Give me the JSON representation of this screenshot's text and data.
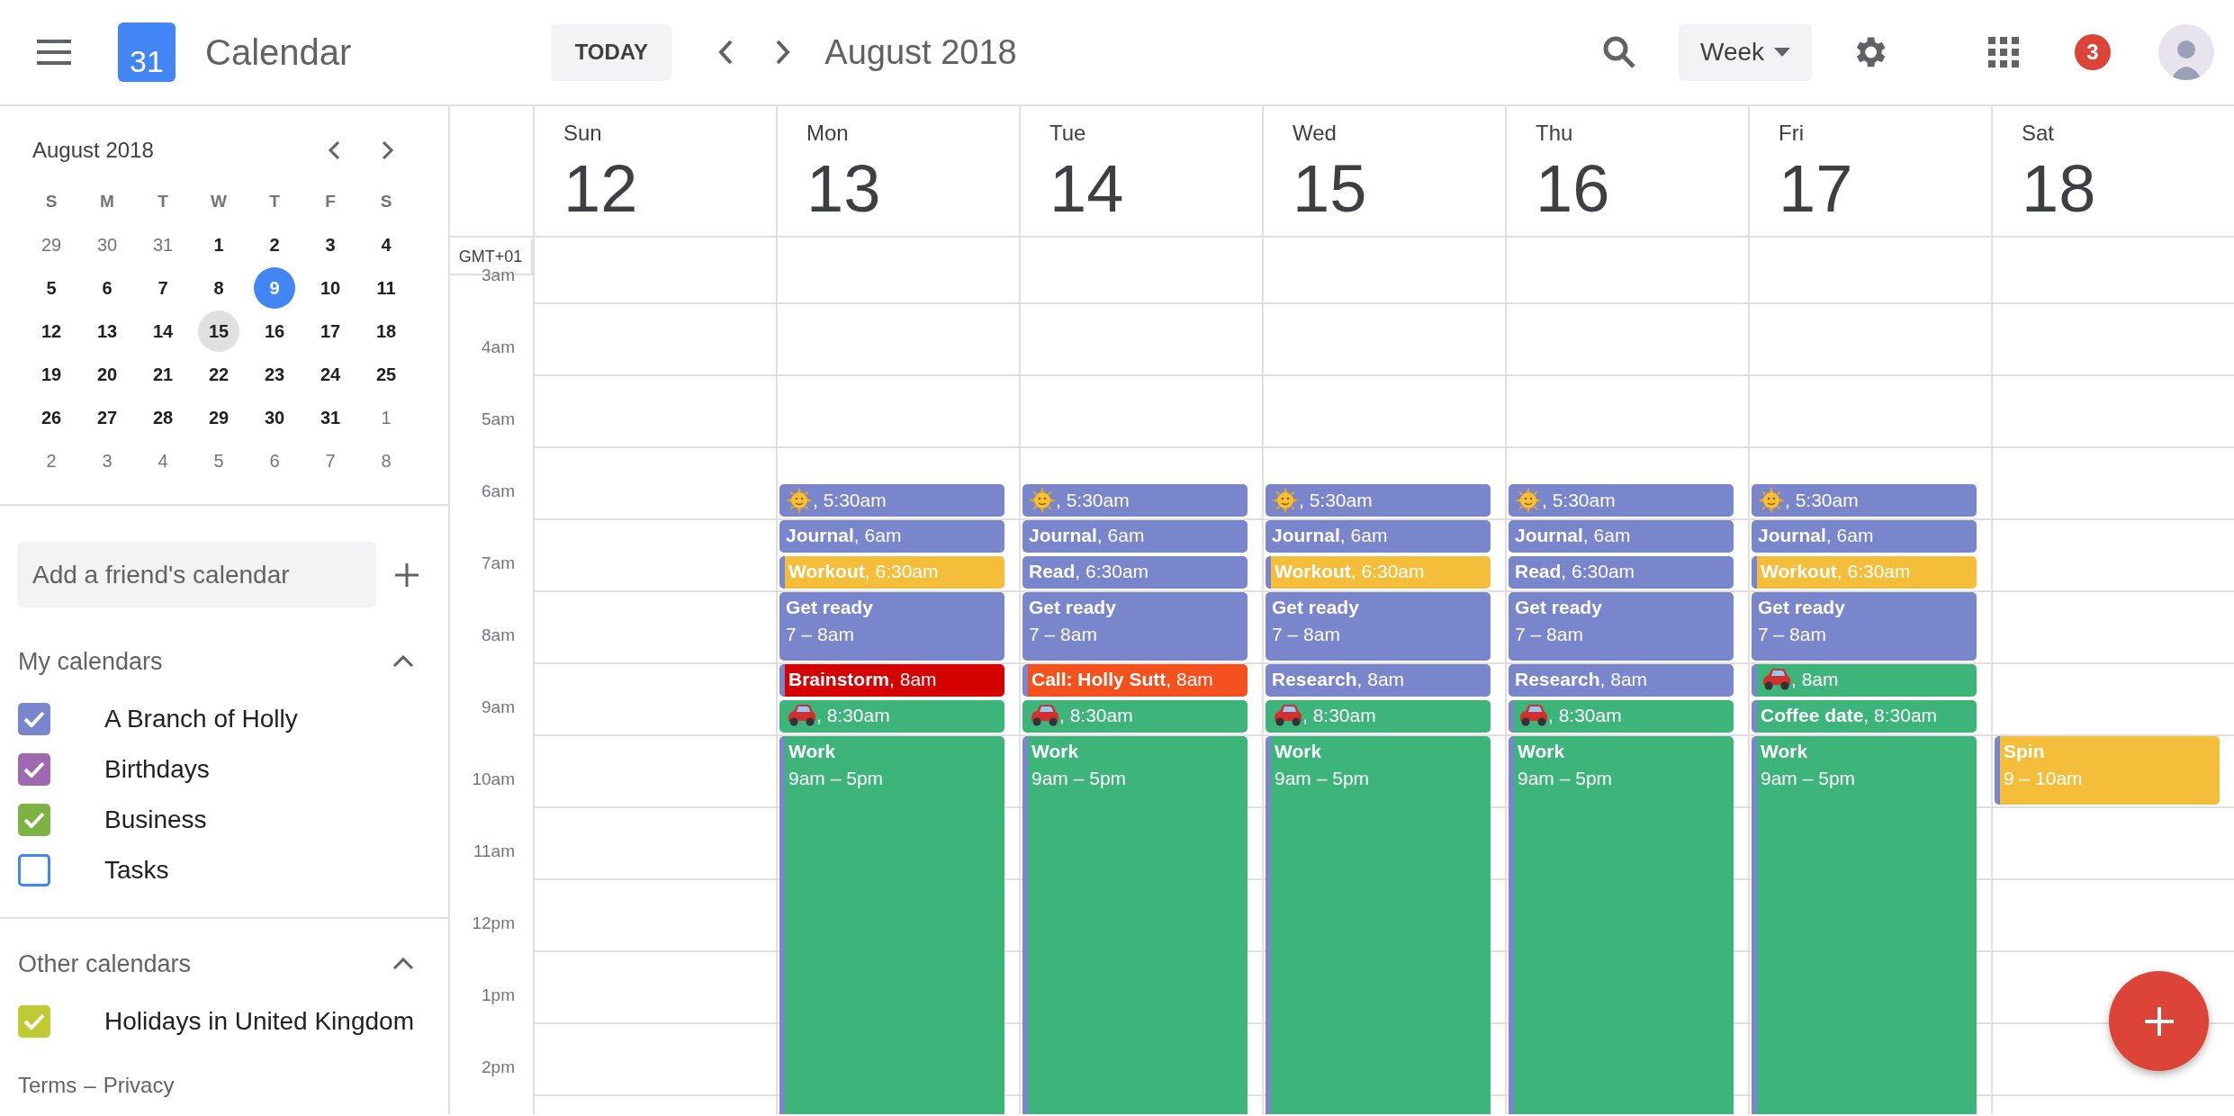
{
  "header": {
    "app_title": "Calendar",
    "logo_text": "31",
    "today_button": "TODAY",
    "period": "August 2018",
    "view": "Week",
    "notification_count": "3"
  },
  "mini_calendar": {
    "title": "August 2018",
    "weekdays": [
      "S",
      "M",
      "T",
      "W",
      "T",
      "F",
      "S"
    ],
    "weeks": [
      [
        {
          "day": "29",
          "muted": true,
          "today": false,
          "selected": false
        },
        {
          "day": "30",
          "muted": true,
          "today": false,
          "selected": false
        },
        {
          "day": "31",
          "muted": true,
          "today": false,
          "selected": false
        },
        {
          "day": "1",
          "muted": false,
          "today": false,
          "selected": false
        },
        {
          "day": "2",
          "muted": false,
          "today": false,
          "selected": false
        },
        {
          "day": "3",
          "muted": false,
          "today": false,
          "selected": false
        },
        {
          "day": "4",
          "muted": false,
          "today": false,
          "selected": false
        }
      ],
      [
        {
          "day": "5",
          "muted": false,
          "today": false,
          "selected": false
        },
        {
          "day": "6",
          "muted": false,
          "today": false,
          "selected": false
        },
        {
          "day": "7",
          "muted": false,
          "today": false,
          "selected": false
        },
        {
          "day": "8",
          "muted": false,
          "today": false,
          "selected": false
        },
        {
          "day": "9",
          "muted": false,
          "today": true,
          "selected": false
        },
        {
          "day": "10",
          "muted": false,
          "today": false,
          "selected": false
        },
        {
          "day": "11",
          "muted": false,
          "today": false,
          "selected": false
        }
      ],
      [
        {
          "day": "12",
          "muted": false,
          "today": false,
          "selected": false
        },
        {
          "day": "13",
          "muted": false,
          "today": false,
          "selected": false
        },
        {
          "day": "14",
          "muted": false,
          "today": false,
          "selected": false
        },
        {
          "day": "15",
          "muted": false,
          "today": false,
          "selected": true
        },
        {
          "day": "16",
          "muted": false,
          "today": false,
          "selected": false
        },
        {
          "day": "17",
          "muted": false,
          "today": false,
          "selected": false
        },
        {
          "day": "18",
          "muted": false,
          "today": false,
          "selected": false
        }
      ],
      [
        {
          "day": "19",
          "muted": false,
          "today": false,
          "selected": false
        },
        {
          "day": "20",
          "muted": false,
          "today": false,
          "selected": false
        },
        {
          "day": "21",
          "muted": false,
          "today": false,
          "selected": false
        },
        {
          "day": "22",
          "muted": false,
          "today": false,
          "selected": false
        },
        {
          "day": "23",
          "muted": false,
          "today": false,
          "selected": false
        },
        {
          "day": "24",
          "muted": false,
          "today": false,
          "selected": false
        },
        {
          "day": "25",
          "muted": false,
          "today": false,
          "selected": false
        }
      ],
      [
        {
          "day": "26",
          "muted": false,
          "today": false,
          "selected": false
        },
        {
          "day": "27",
          "muted": false,
          "today": false,
          "selected": false
        },
        {
          "day": "28",
          "muted": false,
          "today": false,
          "selected": false
        },
        {
          "day": "29",
          "muted": false,
          "today": false,
          "selected": false
        },
        {
          "day": "30",
          "muted": false,
          "today": false,
          "selected": false
        },
        {
          "day": "31",
          "muted": false,
          "today": false,
          "selected": false
        },
        {
          "day": "1",
          "muted": true,
          "today": false,
          "selected": false
        }
      ],
      [
        {
          "day": "2",
          "muted": true,
          "today": false,
          "selected": false
        },
        {
          "day": "3",
          "muted": true,
          "today": false,
          "selected": false
        },
        {
          "day": "4",
          "muted": true,
          "today": false,
          "selected": false
        },
        {
          "day": "5",
          "muted": true,
          "today": false,
          "selected": false
        },
        {
          "day": "6",
          "muted": true,
          "today": false,
          "selected": false
        },
        {
          "day": "7",
          "muted": true,
          "today": false,
          "selected": false
        },
        {
          "day": "8",
          "muted": true,
          "today": false,
          "selected": false
        }
      ]
    ]
  },
  "add_calendar": {
    "placeholder": "Add a friend's calendar"
  },
  "calendar_sections": [
    {
      "title": "My calendars",
      "expanded": true,
      "items": [
        {
          "label": "A Branch of Holly",
          "checked": true,
          "color": "#7986cb"
        },
        {
          "label": "Birthdays",
          "checked": true,
          "color": "#9e69af"
        },
        {
          "label": "Business",
          "checked": true,
          "color": "#7cb342"
        },
        {
          "label": "Tasks",
          "checked": false,
          "color": "#4285f4"
        }
      ]
    },
    {
      "title": "Other calendars",
      "expanded": true,
      "items": [
        {
          "label": "Holidays in United Kingdom",
          "checked": true,
          "color": "#c0ca33"
        }
      ]
    }
  ],
  "footer": {
    "links": [
      "Terms",
      "Privacy"
    ],
    "separator": "–"
  },
  "timezone": "GMT+01",
  "hours": [
    "3am",
    "4am",
    "5am",
    "6am",
    "7am",
    "8am",
    "9am",
    "10am",
    "11am",
    "12pm",
    "1pm",
    "2pm"
  ],
  "days": [
    {
      "name": "Sun",
      "date": "12"
    },
    {
      "name": "Mon",
      "date": "13",
      "events": [
        {
          "kind": "sun",
          "text": ", 5:30am",
          "color": "#7986cb"
        },
        {
          "kind": "short",
          "text": "**Journal**, 6am",
          "color": "#7986cb"
        },
        {
          "kind": "short",
          "text": "**Workout**, 6:30am",
          "color": "#f4be3a",
          "accent": {
            "color": "#7986cb"
          }
        },
        {
          "kind": "long",
          "title": "Get ready",
          "time": "7 – 8am",
          "color": "#7986cb"
        },
        {
          "kind": "short",
          "text": "**Brainstorm**, 8am",
          "color": "#d50000",
          "accent": {
            "color": "#7986cb"
          }
        },
        {
          "kind": "car",
          "text": ", 8:30am",
          "color": "#3cb47a"
        },
        {
          "kind": "long",
          "title": "Work",
          "time": "9am – 5pm",
          "color": "#3cb47a",
          "accent": {
            "color": "#7986cb"
          }
        }
      ]
    },
    {
      "name": "Tue",
      "date": "14",
      "events": [
        {
          "kind": "sun",
          "text": ", 5:30am",
          "color": "#7986cb"
        },
        {
          "kind": "short",
          "text": "**Journal**, 6am",
          "color": "#7986cb"
        },
        {
          "kind": "short",
          "text": "**Read**, 6:30am",
          "color": "#7986cb"
        },
        {
          "kind": "long",
          "title": "Get ready",
          "time": "7 – 8am",
          "color": "#7986cb"
        },
        {
          "kind": "short",
          "text": "**Call: Holly Sutt**, 8am",
          "color": "#f4511e",
          "accent": {
            "color": "#7986cb"
          }
        },
        {
          "kind": "car",
          "text": ", 8:30am",
          "color": "#3cb47a"
        },
        {
          "kind": "long",
          "title": "Work",
          "time": "9am – 5pm",
          "color": "#3cb47a",
          "accent": {
            "color": "#7986cb"
          }
        }
      ]
    },
    {
      "name": "Wed",
      "date": "15",
      "events": [
        {
          "kind": "sun",
          "text": ", 5:30am",
          "color": "#7986cb"
        },
        {
          "kind": "short",
          "text": "**Journal**, 6am",
          "color": "#7986cb"
        },
        {
          "kind": "short",
          "text": "**Workout**, 6:30am",
          "color": "#f4be3a",
          "accent": {
            "color": "#7986cb"
          }
        },
        {
          "kind": "long",
          "title": "Get ready",
          "time": "7 – 8am",
          "color": "#7986cb"
        },
        {
          "kind": "short",
          "text": "**Research**, 8am",
          "color": "#7986cb"
        },
        {
          "kind": "car",
          "text": ", 8:30am",
          "color": "#3cb47a"
        },
        {
          "kind": "long",
          "title": "Work",
          "time": "9am – 5pm",
          "color": "#3cb47a",
          "accent": {
            "color": "#7986cb"
          }
        }
      ]
    },
    {
      "name": "Thu",
      "date": "16",
      "events": [
        {
          "kind": "sun",
          "text": ", 5:30am",
          "color": "#7986cb"
        },
        {
          "kind": "short",
          "text": "**Journal**, 6am",
          "color": "#7986cb"
        },
        {
          "kind": "short",
          "text": "**Read**, 6:30am",
          "color": "#7986cb"
        },
        {
          "kind": "long",
          "title": "Get ready",
          "time": "7 – 8am",
          "color": "#7986cb"
        },
        {
          "kind": "short",
          "text": "**Research**, 8am",
          "color": "#7986cb"
        },
        {
          "kind": "car",
          "text": ", 8:30am",
          "color": "#3cb47a",
          "accent": {
            "color": "#7986cb"
          }
        },
        {
          "kind": "long",
          "title": "Work",
          "time": "9am – 5pm",
          "color": "#3cb47a",
          "accent": {
            "color": "#7986cb"
          }
        }
      ]
    },
    {
      "name": "Fri",
      "date": "17",
      "events": [
        {
          "kind": "sun",
          "text": ", 5:30am",
          "color": "#7986cb"
        },
        {
          "kind": "short",
          "text": "**Journal**, 6am",
          "color": "#7986cb"
        },
        {
          "kind": "short",
          "text": "**Workout**, 6:30am",
          "color": "#f4be3a",
          "accent": {
            "color": "#7986cb"
          }
        },
        {
          "kind": "long",
          "title": "Get ready",
          "time": "7 – 8am",
          "color": "#7986cb"
        },
        {
          "kind": "car",
          "text": ", 8am",
          "color": "#3cb47a",
          "accent": {
            "color": "#7986cb"
          }
        },
        {
          "kind": "short",
          "text": "**Coffee date**, 8:30am",
          "color": "#3cb47a",
          "accent": {
            "color": "#7986cb"
          }
        },
        {
          "kind": "long",
          "title": "Work",
          "time": "9am – 5pm",
          "color": "#3cb47a",
          "accent": {
            "color": "#7986cb"
          }
        }
      ]
    },
    {
      "name": "Sat",
      "date": "18",
      "events": [
        {
          "kind": "long",
          "title": "Spin",
          "time": "9 – 10am",
          "color": "#f4be3a",
          "accent": {
            "color": "#7986cb"
          }
        }
      ]
    }
  ]
}
